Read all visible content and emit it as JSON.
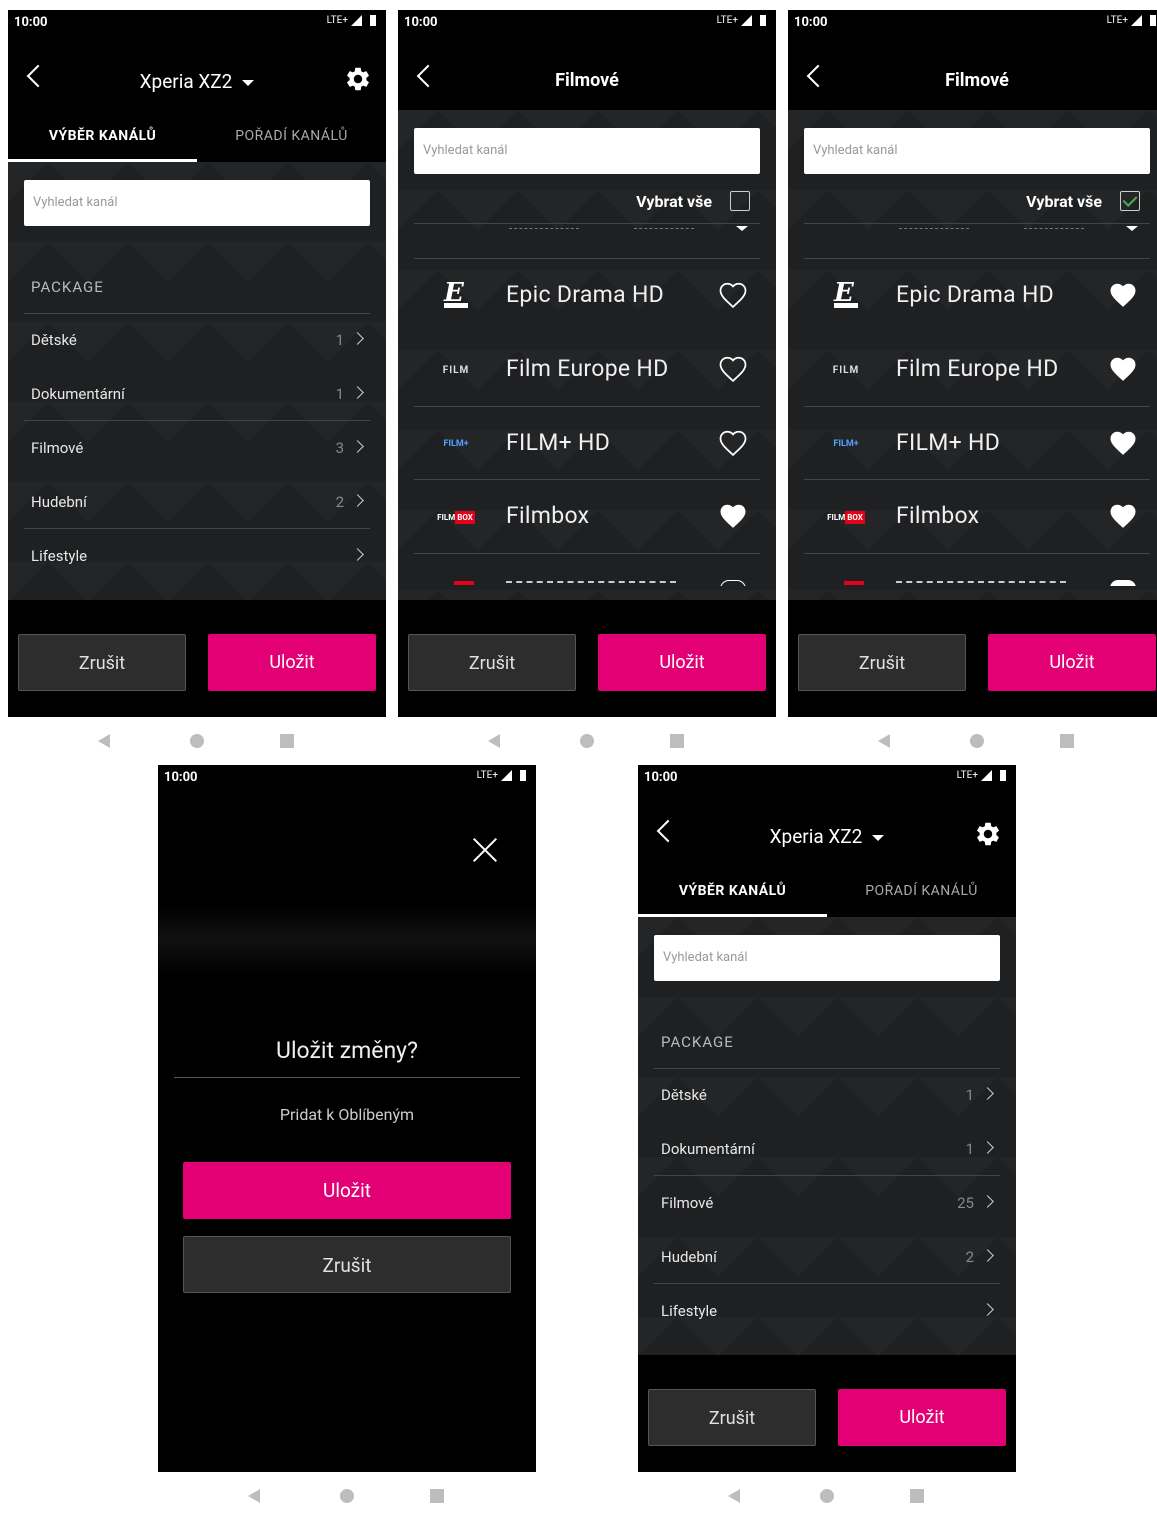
{
  "status": {
    "time": "10:00",
    "network": "LTE+"
  },
  "screen1": {
    "device_title": "Xperia XZ2",
    "tabs": [
      "VÝBĚR KANÁLŮ",
      "POŘADÍ KANÁLŮ"
    ],
    "search_placeholder": "Vyhledat kanál",
    "section_title": "PACKAGE",
    "categories": [
      {
        "label": "Dětské",
        "count": "1"
      },
      {
        "label": "Dokumentární",
        "count": "1"
      },
      {
        "label": "Filmové",
        "count": "3"
      },
      {
        "label": "Hudební",
        "count": "2"
      },
      {
        "label": "Lifestyle",
        "count": ""
      }
    ],
    "cancel": "Zrušit",
    "save": "Uložit"
  },
  "screen2": {
    "title": "Filmové",
    "search_placeholder": "Vyhledat kanál",
    "select_all": "Vybrat vše",
    "select_all_checked": false,
    "channels": [
      {
        "name": "Epic Drama HD",
        "logo": "EPIC",
        "favorite": false
      },
      {
        "name": "Film Europe HD",
        "logo": "FILM",
        "favorite": false
      },
      {
        "name": "FILM+ HD",
        "logo": "FILM+",
        "favorite": false
      },
      {
        "name": "Filmbox",
        "logo": "FILMBOX",
        "favorite": true
      }
    ],
    "cancel": "Zrušit",
    "save": "Uložit"
  },
  "screen3": {
    "title": "Filmové",
    "search_placeholder": "Vyhledat kanál",
    "select_all": "Vybrat vše",
    "select_all_checked": true,
    "channels": [
      {
        "name": "Epic Drama HD",
        "logo": "EPIC",
        "favorite": true
      },
      {
        "name": "Film Europe HD",
        "logo": "FILM",
        "favorite": true
      },
      {
        "name": "FILM+ HD",
        "logo": "FILM+",
        "favorite": true
      },
      {
        "name": "Filmbox",
        "logo": "FILMBOX",
        "favorite": true
      }
    ],
    "cancel": "Zrušit",
    "save": "Uložit"
  },
  "modal": {
    "title": "Uložit změny?",
    "message": "Pridat k Oblíbeným",
    "save": "Uložit",
    "cancel": "Zrušit"
  },
  "screen5": {
    "device_title": "Xperia XZ2",
    "tabs": [
      "VÝBĚR KANÁLŮ",
      "POŘADÍ KANÁLŮ"
    ],
    "search_placeholder": "Vyhledat kanál",
    "section_title": "PACKAGE",
    "categories": [
      {
        "label": "Dětské",
        "count": "1"
      },
      {
        "label": "Dokumentární",
        "count": "1"
      },
      {
        "label": "Filmové",
        "count": "25"
      },
      {
        "label": "Hudební",
        "count": "2"
      },
      {
        "label": "Lifestyle",
        "count": ""
      }
    ],
    "cancel": "Zrušit",
    "save": "Uložit"
  },
  "colors": {
    "accent": "#e20074",
    "content_bg": "#1f2022",
    "button_bg": "#2d2d2d"
  }
}
